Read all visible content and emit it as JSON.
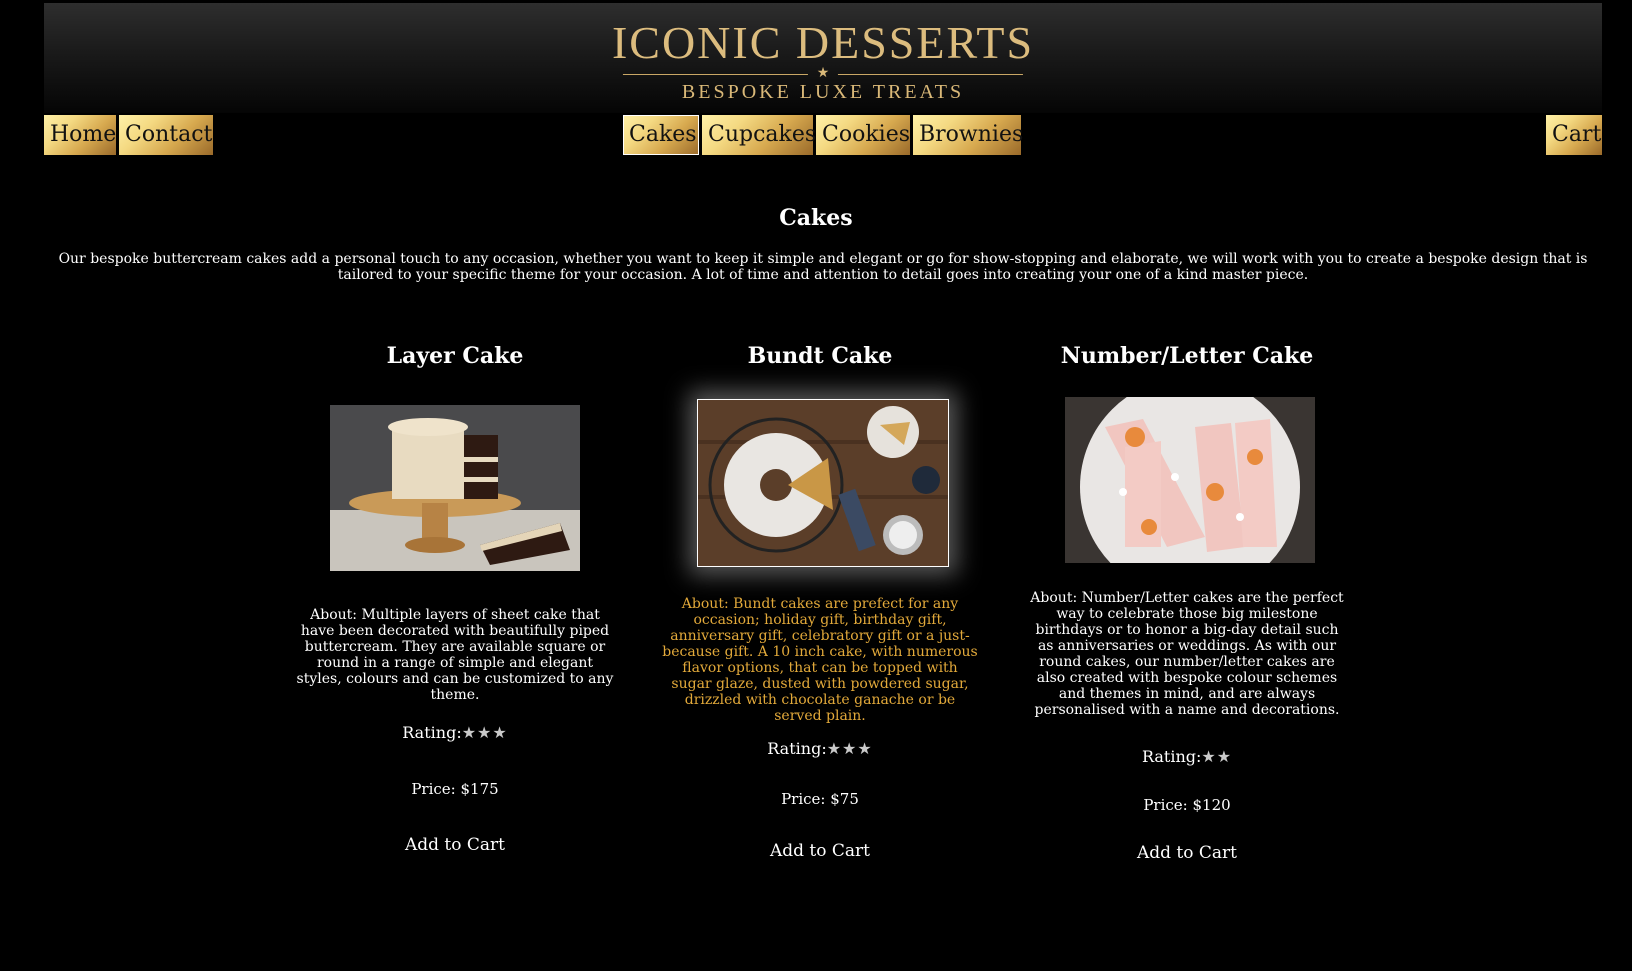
{
  "header": {
    "logo_title": "ICONIC DESSERTS",
    "logo_subtitle": "BESPOKE LUXE TREATS"
  },
  "nav": {
    "left": [
      "Home",
      "Contact"
    ],
    "center": [
      "Cakes",
      "Cupcakes",
      "Cookies",
      "Brownies"
    ],
    "right": [
      "Cart"
    ],
    "active": "Cakes"
  },
  "page": {
    "title": "Cakes",
    "intro": "Our bespoke buttercream cakes add a personal touch to any occasion, whether you want to keep it simple and elegant or go for show-stopping and elaborate, we will work with you to create a bespoke design that is tailored to your specific theme for your occasion. A lot of time and attention to detail goes into creating your one of a kind master piece."
  },
  "products": [
    {
      "title": "Layer Cake",
      "about": "About: Multiple layers of sheet cake that have been decorated with beautifully piped buttercream. They are available square or round in a range of simple and elegant styles, colours and can be customized to any theme.",
      "rating_label": "Rating:",
      "stars": "★★★",
      "rating": 3,
      "price": "Price: $175",
      "add_to_cart": "Add to Cart"
    },
    {
      "title": "Bundt Cake",
      "about": "About: Bundt cakes are prefect for any occasion; holiday gift, birthday gift, anniversary gift, celebratory gift or a just-because gift. A 10 inch cake, with numerous flavor options, that can be topped with sugar glaze, dusted with powdered sugar, drizzled with chocolate ganache or be served plain.",
      "rating_label": "Rating:",
      "stars": "★★★",
      "rating": 3,
      "price": "Price: $75",
      "add_to_cart": "Add to Cart"
    },
    {
      "title": "Number/Letter Cake",
      "about": "About: Number/Letter cakes are the perfect way to celebrate those big milestone birthdays or to honor a big-day detail such as anniversaries or weddings. As with our round cakes, our number/letter cakes are also created with bespoke colour schemes and themes in mind, and are always personalised with a name and decorations.",
      "rating_label": "Rating:",
      "stars": "★★",
      "rating": 2,
      "price": "Price: $120",
      "add_to_cart": "Add to Cart"
    }
  ],
  "colors": {
    "background": "#000000",
    "gold_text": "#d9b878",
    "highlight_text": "#e2a93a"
  }
}
